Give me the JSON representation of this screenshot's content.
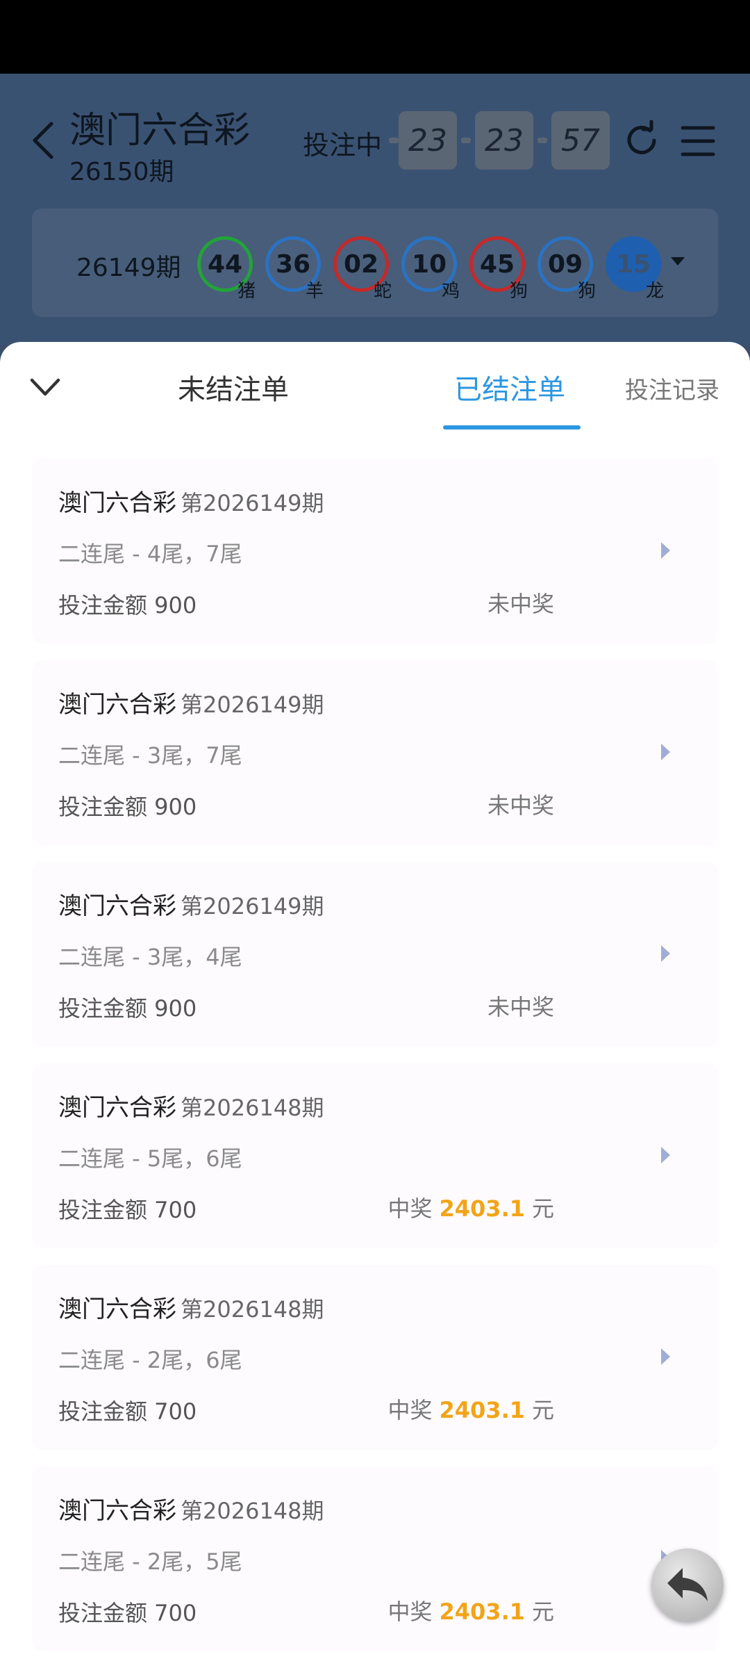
{
  "header": {
    "title": "澳门六合彩",
    "period": "26150期",
    "betting_label": "投注中",
    "timer": [
      "23",
      "23",
      "57"
    ]
  },
  "last_draw": {
    "period": "26149期",
    "balls": [
      {
        "number": "44",
        "zodiac": "猪",
        "color": "#22a33a"
      },
      {
        "number": "36",
        "zodiac": "羊",
        "color": "#2a72c4"
      },
      {
        "number": "02",
        "zodiac": "蛇",
        "color": "#c42a2a"
      },
      {
        "number": "10",
        "zodiac": "鸡",
        "color": "#2a72c4"
      },
      {
        "number": "45",
        "zodiac": "狗",
        "color": "#c42a2a"
      },
      {
        "number": "09",
        "zodiac": "狗",
        "color": "#2a72c4"
      },
      {
        "number": "15",
        "zodiac": "龙",
        "color": "#1e5fb0"
      }
    ]
  },
  "tabs": {
    "unsettled": "未结注单",
    "settled": "已结注单",
    "records": "投注记录",
    "active": "settled"
  },
  "bets": [
    {
      "title": "澳门六合彩",
      "issue": "第2026149期",
      "desc": "二连尾 - 4尾，7尾",
      "amount": "投注金额 900",
      "status": "未中奖",
      "win": null
    },
    {
      "title": "澳门六合彩",
      "issue": "第2026149期",
      "desc": "二连尾 - 3尾，7尾",
      "amount": "投注金额 900",
      "status": "未中奖",
      "win": null
    },
    {
      "title": "澳门六合彩",
      "issue": "第2026149期",
      "desc": "二连尾 - 3尾，4尾",
      "amount": "投注金额 900",
      "status": "未中奖",
      "win": null
    },
    {
      "title": "澳门六合彩",
      "issue": "第2026148期",
      "desc": "二连尾 - 5尾，6尾",
      "amount": "投注金额 700",
      "status": "中奖",
      "win": "2403.1",
      "unit": "元"
    },
    {
      "title": "澳门六合彩",
      "issue": "第2026148期",
      "desc": "二连尾 - 2尾，6尾",
      "amount": "投注金额 700",
      "status": "中奖",
      "win": "2403.1",
      "unit": "元"
    },
    {
      "title": "澳门六合彩",
      "issue": "第2026148期",
      "desc": "二连尾 - 2尾，5尾",
      "amount": "投注金额 700",
      "status": "中奖",
      "win": "2403.1",
      "unit": "元"
    }
  ],
  "colors": {
    "accent": "#2c97e0",
    "win": "#f2a418"
  }
}
